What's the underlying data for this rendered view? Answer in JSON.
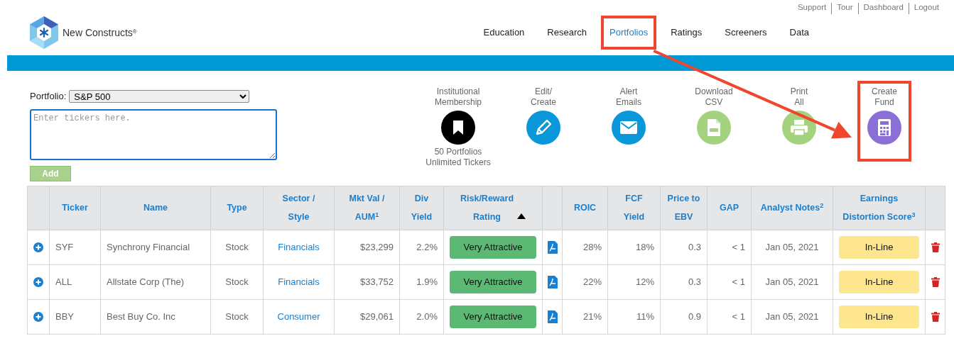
{
  "top_links": [
    "Support",
    "Tour",
    "Dashboard",
    "Logout"
  ],
  "brand": {
    "name": "New Constructs",
    "mark": "®"
  },
  "nav": [
    {
      "label": "Education",
      "selected": false,
      "highlighted": false
    },
    {
      "label": "Research",
      "selected": false,
      "highlighted": false
    },
    {
      "label": "Portfolios",
      "selected": true,
      "highlighted": true
    },
    {
      "label": "Ratings",
      "selected": false,
      "highlighted": false
    },
    {
      "label": "Screeners",
      "selected": false,
      "highlighted": false
    },
    {
      "label": "Data",
      "selected": false,
      "highlighted": false
    }
  ],
  "portfolio": {
    "label": "Portfolio:",
    "value": "S&P 500",
    "placeholder": "Enter tickers here.",
    "add_button": "Add"
  },
  "actions": [
    {
      "kind": "bookmark",
      "label_lines": [
        "Institutional",
        "Membership"
      ],
      "color": "#000000",
      "note_lines": [
        "50 Portfolios",
        "Unlimited Tickers"
      ],
      "highlighted": false
    },
    {
      "kind": "pencil",
      "label_lines": [
        "Edit/",
        "Create"
      ],
      "color": "#0a97d9",
      "highlighted": false
    },
    {
      "kind": "envelope",
      "label_lines": [
        "Alert",
        "Emails"
      ],
      "color": "#0a97d9",
      "highlighted": false
    },
    {
      "kind": "csv",
      "label_lines": [
        "Download",
        "CSV"
      ],
      "color": "#a5d27e",
      "highlighted": false
    },
    {
      "kind": "printer",
      "label_lines": [
        "Print",
        "All"
      ],
      "color": "#a5d27e",
      "highlighted": false
    },
    {
      "kind": "calculator",
      "label_lines": [
        "Create",
        "Fund"
      ],
      "color": "#8c6fd6",
      "highlighted": true
    }
  ],
  "callout_arrow": true,
  "table": {
    "columns": [
      {},
      {
        "label_lines": [
          "Ticker"
        ]
      },
      {
        "label_lines": [
          "Name"
        ]
      },
      {
        "label_lines": [
          "Type"
        ]
      },
      {
        "label_lines": [
          "Sector /",
          "Style"
        ]
      },
      {
        "label_lines": [
          "Mkt Val /",
          "AUM$^{1}$"
        ]
      },
      {
        "label_lines": [
          "Div",
          "Yield"
        ]
      },
      {
        "label_lines": [
          "Risk/Reward",
          "Rating"
        ],
        "sorted_ascending": true
      },
      {},
      {
        "label_lines": [
          "ROIC"
        ]
      },
      {
        "label_lines": [
          "FCF",
          "Yield"
        ]
      },
      {
        "label_lines": [
          "Price to",
          "EBV"
        ]
      },
      {
        "label_lines": [
          "GAP"
        ]
      },
      {
        "label_lines": [
          "Analyst Notes$^{2}$"
        ]
      },
      {
        "label_lines": [
          "Earnings",
          "Distortion Score$^{3}$"
        ]
      },
      {}
    ],
    "rows": [
      {
        "ticker": "SYF",
        "name": "Synchrony Financial",
        "type": "Stock",
        "sector": "Financials",
        "mkt_val": "$23,299",
        "div_yield": "2.2%",
        "rating": "Very Attractive",
        "roic": "28%",
        "fcf_yield": "18%",
        "price_to_ebv": "0.3",
        "gap": "< 1",
        "analyst_notes": "Jan 05, 2021",
        "eds": "In-Line"
      },
      {
        "ticker": "ALL",
        "name": "Allstate Corp (The)",
        "type": "Stock",
        "sector": "Financials",
        "mkt_val": "$33,752",
        "div_yield": "1.9%",
        "rating": "Very Attractive",
        "roic": "22%",
        "fcf_yield": "12%",
        "price_to_ebv": "0.3",
        "gap": "< 1",
        "analyst_notes": "Jan 05, 2021",
        "eds": "In-Line"
      },
      {
        "ticker": "BBY",
        "name": "Best Buy Co. Inc",
        "type": "Stock",
        "sector": "Consumer",
        "mkt_val": "$29,061",
        "div_yield": "2.0%",
        "rating": "Very Attractive",
        "roic": "21%",
        "fcf_yield": "11%",
        "price_to_ebv": "0.9",
        "gap": "< 1",
        "analyst_notes": "Jan 05, 2021",
        "eds": "In-Line"
      }
    ]
  }
}
